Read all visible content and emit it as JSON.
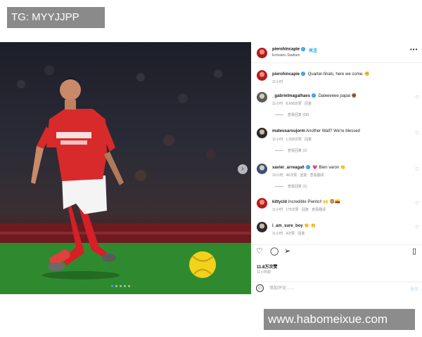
{
  "watermarks": {
    "top_left": "TG: MYYJJPP",
    "bottom_right": "www.habomeixue.com"
  },
  "post": {
    "username": "pierohincapie",
    "location": "Emirates Stadium",
    "follow_label": "关注",
    "caption_user": "pierohincapie",
    "caption_text": "Quarter-finals, here we come. ✊",
    "caption_time": "11小时",
    "likes": "11.8万次赞",
    "date": "11小时前",
    "comment_placeholder": "添加评论……",
    "post_label": "发布",
    "more_icon": "more-dots-icon",
    "slide_count": 5,
    "active_slide": 1
  },
  "photo": {
    "shirt_sponsor": "Emirates FLY BETTER",
    "number": "5"
  },
  "comments": [
    {
      "user": "_gabrielmagalhaes",
      "verified": true,
      "text": "Daleeeeee papai ✊🏾",
      "time": "11小时",
      "likes": "8,668次赞",
      "reply": "回复",
      "extra": "",
      "view_replies": "查看回复 (58)",
      "avatar": "av-grey"
    },
    {
      "user": "mateusarsujorm",
      "verified": false,
      "text": "Another Wall? We're blessed",
      "time": "11小时",
      "likes": "1,558次赞",
      "reply": "回复",
      "extra": "",
      "view_replies": "查看回复 (2)",
      "avatar": "av-dark"
    },
    {
      "user": "xavier_arreaga6",
      "verified": true,
      "text": "💗 Bien varon 👏",
      "time": "10小时",
      "likes": "46次赞",
      "reply": "回复",
      "extra": "查看翻译",
      "view_replies": "查看回复 (1)",
      "avatar": "av-blue"
    },
    {
      "user": "kittycld",
      "verified": false,
      "text": "Incredible Pierito!! 🙌 🦁🇪🇨",
      "time": "11小时",
      "likes": "175次赞",
      "reply": "回复",
      "extra": "查看翻译",
      "view_replies": "",
      "avatar": "av-red"
    },
    {
      "user": "i_am_sure_boy",
      "verified": false,
      "text": "👏 👏",
      "time": "11小时",
      "likes": "4次赞",
      "reply": "回复",
      "extra": "",
      "view_replies": "",
      "avatar": "av-dark"
    }
  ]
}
